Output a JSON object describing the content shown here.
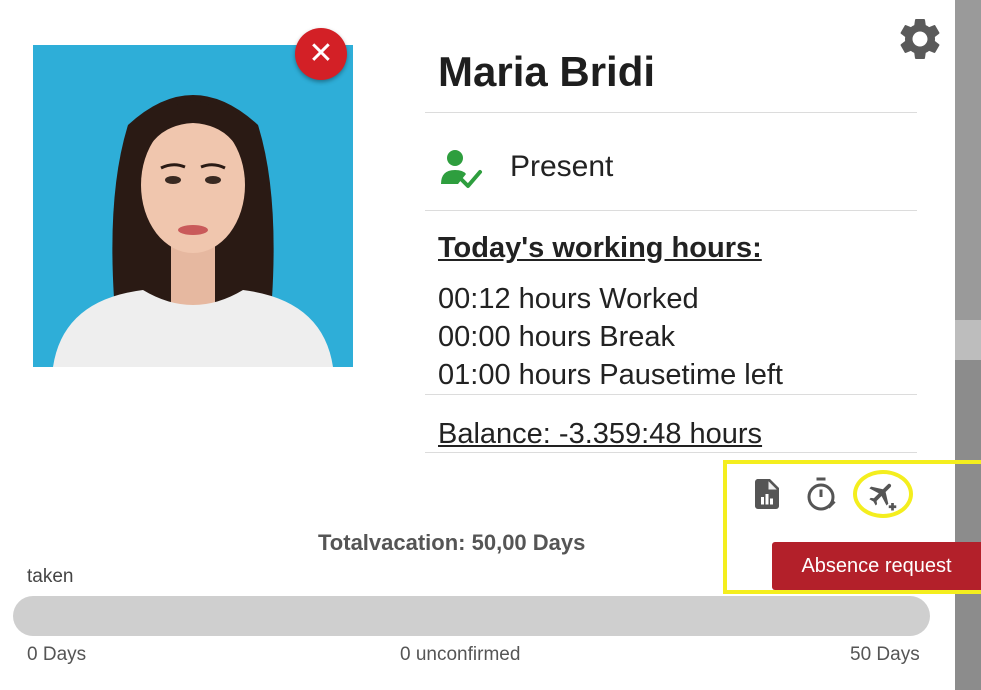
{
  "employee": {
    "name": "Maria Bridi",
    "status": "Present",
    "photo_bg": "#2eaed8"
  },
  "working_hours": {
    "title": "Today's working hours:",
    "worked": "00:12 hours Worked",
    "break": "00:00 hours Break",
    "pausetime_left": "01:00 hours Pausetime left"
  },
  "balance": "Balance: -3.359:48 hours",
  "actions": {
    "icons": [
      "report-icon",
      "stopwatch-icon",
      "flight-add-icon"
    ],
    "absence_request_label": "Absence request"
  },
  "vacation": {
    "total": "Totalvacation: 50,00 Days",
    "taken_label": "taken",
    "min_label": "0 Days",
    "unconfirmed_label": "0 unconfirmed",
    "max_label": "50 Days",
    "progress": 0
  },
  "colors": {
    "accent_red": "#d32026",
    "button_red": "#b3202a",
    "present_green": "#2e9e3e",
    "highlight": "#f4ee1e"
  }
}
